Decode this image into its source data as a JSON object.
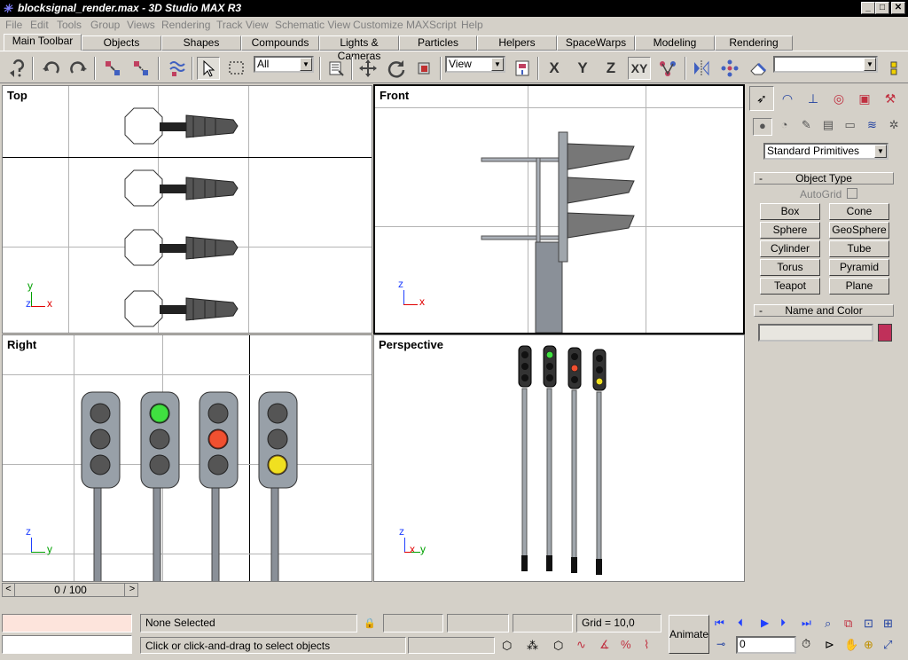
{
  "title": "blocksignal_render.max - 3D Studio MAX R3",
  "window_controls": {
    "minimize": "_",
    "maximize": "□",
    "close": "✕"
  },
  "menu": [
    "File",
    "Edit",
    "Tools",
    "Group",
    "Views",
    "Rendering",
    "Track View",
    "Schematic View",
    "Customize",
    "MAXScript",
    "Help"
  ],
  "tabs": [
    "Main Toolbar",
    "Objects",
    "Shapes",
    "Compounds",
    "Lights & Cameras",
    "Particles",
    "Helpers",
    "SpaceWarps",
    "Modeling",
    "Rendering"
  ],
  "toolbar": {
    "selection_filter": "All",
    "coord_system": "View",
    "axis_x": "X",
    "axis_y": "Y",
    "axis_z": "Z",
    "axis_xy": "XY",
    "named_selection": ""
  },
  "viewports": {
    "top": "Top",
    "front": "Front",
    "right": "Right",
    "perspective": "Perspective"
  },
  "axes": {
    "x": "x",
    "y": "y",
    "z": "z"
  },
  "colors": {
    "signal_green": "#40e040",
    "signal_red": "#f05030",
    "signal_yellow": "#f0e020",
    "name_color_swatch": "#c0305a",
    "status_prompt_bg": "#fde4dc"
  },
  "command_panel": {
    "dropdown": "Standard Primitives",
    "object_type_header": "Object Type",
    "autogrid_label": "AutoGrid",
    "buttons": [
      "Box",
      "Cone",
      "Sphere",
      "GeoSphere",
      "Cylinder",
      "Tube",
      "Torus",
      "Pyramid",
      "Teapot",
      "Plane"
    ],
    "name_color_header": "Name and Color",
    "name_value": ""
  },
  "timeline": {
    "frame": "0 / 100",
    "prev": "<",
    "next": ">"
  },
  "status": {
    "selection": "None Selected",
    "prompt": "Click or click-and-drag to select objects",
    "grid": "Grid = 10,0",
    "animate": "Animate",
    "frame_field": "0"
  }
}
